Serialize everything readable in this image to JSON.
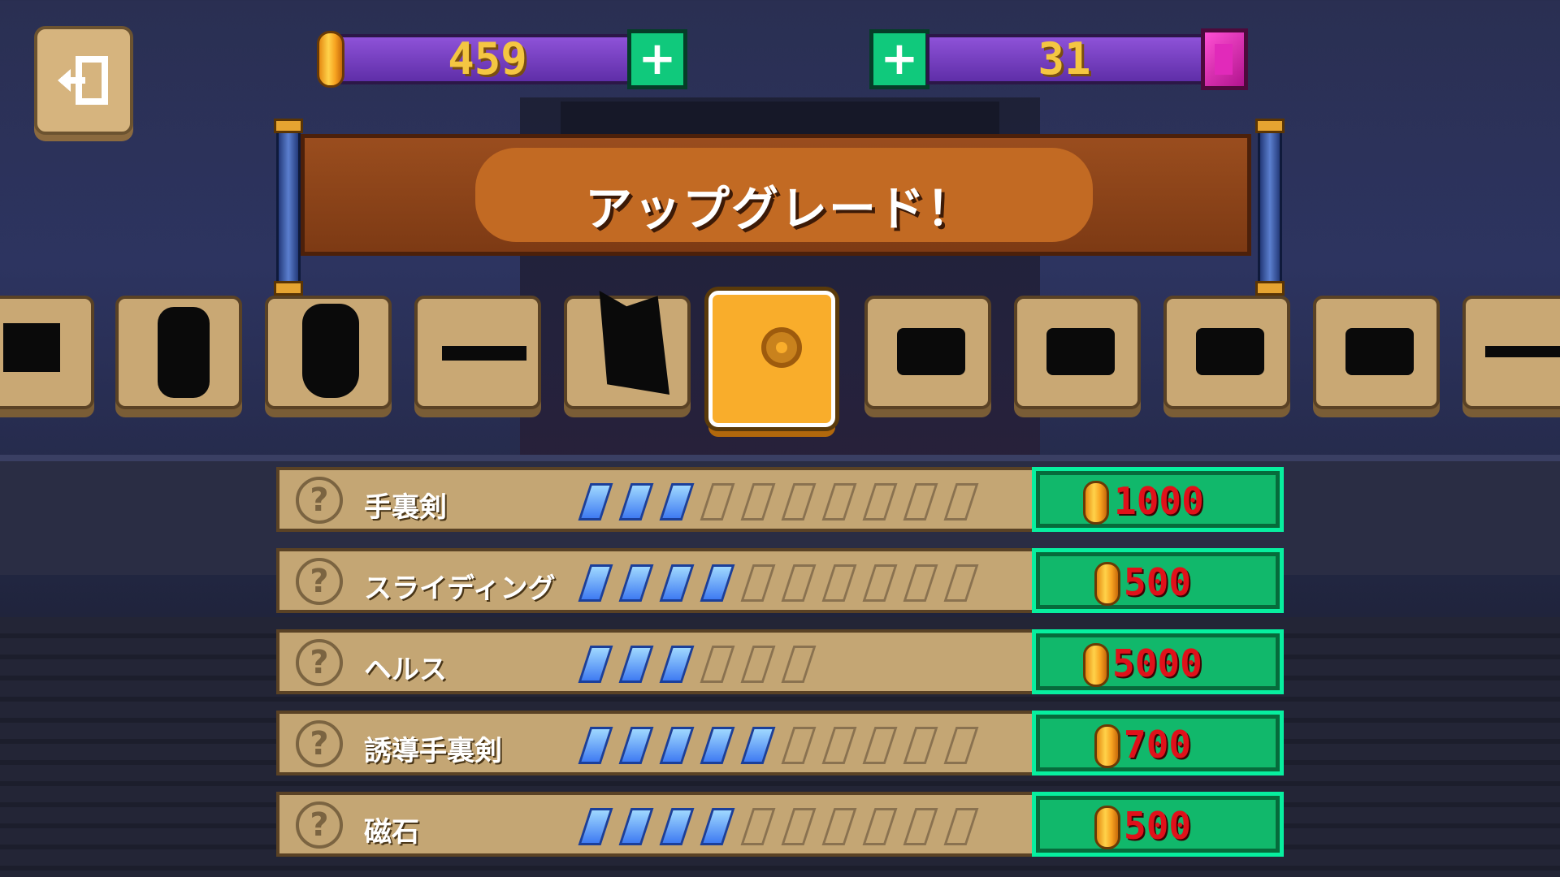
{
  "currency": {
    "coins": "459",
    "gems": "31"
  },
  "banner": {
    "title": "アップグレード！"
  },
  "items": [
    {
      "name": "partial-item-1",
      "locked": true
    },
    {
      "name": "item-2",
      "locked": true
    },
    {
      "name": "item-3",
      "locked": true
    },
    {
      "name": "item-4",
      "locked": true
    },
    {
      "name": "item-5",
      "locked": true
    },
    {
      "name": "shuriken",
      "locked": false,
      "selected": true
    },
    {
      "name": "item-7",
      "locked": true
    },
    {
      "name": "item-8",
      "locked": true
    },
    {
      "name": "item-9",
      "locked": true
    },
    {
      "name": "item-10",
      "locked": true
    },
    {
      "name": "item-11",
      "locked": true
    }
  ],
  "upgrades": [
    {
      "name": "手裏剣",
      "level": 3,
      "max": 10,
      "price": "1000"
    },
    {
      "name": "スライディング",
      "level": 4,
      "max": 10,
      "price": "500"
    },
    {
      "name": "ヘルス",
      "level": 3,
      "max": 6,
      "price": "5000"
    },
    {
      "name": "誘導手裏剣",
      "level": 5,
      "max": 10,
      "price": "700"
    },
    {
      "name": "磁石",
      "level": 4,
      "max": 10,
      "price": "500"
    }
  ],
  "icons": {
    "exit": "exit-icon",
    "coin": "coin-icon",
    "gem": "gem-icon",
    "plus": "plus-icon",
    "help": "help-icon"
  },
  "colors": {
    "accent_green": "#11b86b",
    "price_red": "#e0111a",
    "coin_gold": "#f4c642",
    "gem_pink": "#ff4fd3",
    "pip_blue": "#3f7bf2"
  },
  "labels": {
    "plus": "+",
    "help": "?"
  }
}
